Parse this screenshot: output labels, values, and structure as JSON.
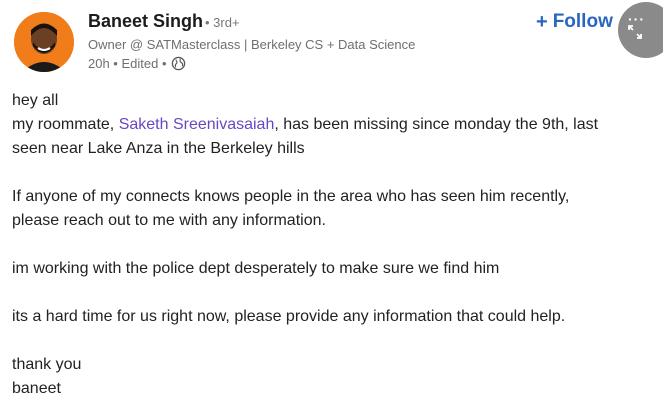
{
  "author": {
    "name": "Baneet Singh",
    "degree": "• 3rd+",
    "headline": "Owner @ SATMasterclass | Berkeley CS + Data Science",
    "time": "20h • Edited •",
    "globe_icon": "globe-icon",
    "avatar_color": "#f07d1a"
  },
  "actions": {
    "follow_label": "Follow",
    "follow_icon": "+",
    "follow_color": "#2a66bf",
    "more_icon": "more-icon"
  },
  "post": {
    "line1": "hey all",
    "line2_before": "my roommate, ",
    "mention": "Saketh Sreenivasaiah",
    "line2_after": ", has been missing since monday the 9th, last",
    "line3": "seen near Lake Anza in the Berkeley hills",
    "line4": "If anyone of my connects knows people in the area who has seen him recently,",
    "line5": "please reach out to me with any information.",
    "line6": "im working with the police dept desperately to make sure we find him",
    "line7": "its a hard time for us right now, please provide any information that could help.",
    "line8": "thank you",
    "line9": "baneet",
    "mention_color": "#6b46c4"
  }
}
